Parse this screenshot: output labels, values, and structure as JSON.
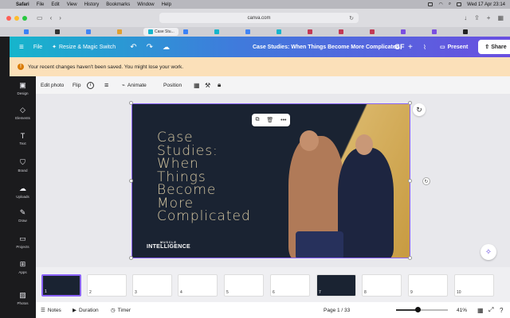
{
  "menubar": {
    "app": "Safari",
    "items": [
      "File",
      "Edit",
      "View",
      "History",
      "Bookmarks",
      "Window",
      "Help"
    ],
    "clock": "Wed 17 Apr 23:14"
  },
  "browser": {
    "url": "canva.com",
    "active_tab": "Case Stu..."
  },
  "header": {
    "file": "File",
    "resize": "Resize & Magic Switch",
    "doc_title": "Case Studies: When Things Become More Complicated",
    "avatar": "GF",
    "present": "Present",
    "share": "Share",
    "gradient_start": "#16b5cc",
    "gradient_end": "#6a4fe0"
  },
  "banner": {
    "text": "Your recent changes haven't been saved. You might lose your work.",
    "color": "#fbe0b9"
  },
  "sidebar": {
    "items": [
      {
        "label": "Design",
        "icon": "design-icon"
      },
      {
        "label": "Elements",
        "icon": "elements-icon"
      },
      {
        "label": "Text",
        "icon": "text-icon"
      },
      {
        "label": "Brand",
        "icon": "brand-icon"
      },
      {
        "label": "Uploads",
        "icon": "uploads-icon"
      },
      {
        "label": "Draw",
        "icon": "draw-icon"
      },
      {
        "label": "Projects",
        "icon": "projects-icon"
      },
      {
        "label": "Apps",
        "icon": "apps-icon"
      },
      {
        "label": "Photos",
        "icon": "photos-icon"
      }
    ]
  },
  "toolbar": {
    "edit_photo": "Edit photo",
    "flip": "Flip",
    "animate": "Animate",
    "position": "Position"
  },
  "slide": {
    "title": "Case\nStudies:\nWhen\nThings\nBecome\nMore\nComplicated",
    "logo_top": "MUSCLE",
    "logo": "INTELLIGENCE",
    "bg": "#1a2332",
    "accent": "#d9b567"
  },
  "thumbnails": [
    "1",
    "2",
    "3",
    "4",
    "5",
    "6",
    "7",
    "8",
    "9",
    "10"
  ],
  "footer": {
    "notes": "Notes",
    "duration": "Duration",
    "timer": "Timer",
    "page": "Page 1 / 33",
    "zoom": "41%",
    "zoom_level": 0.41
  }
}
